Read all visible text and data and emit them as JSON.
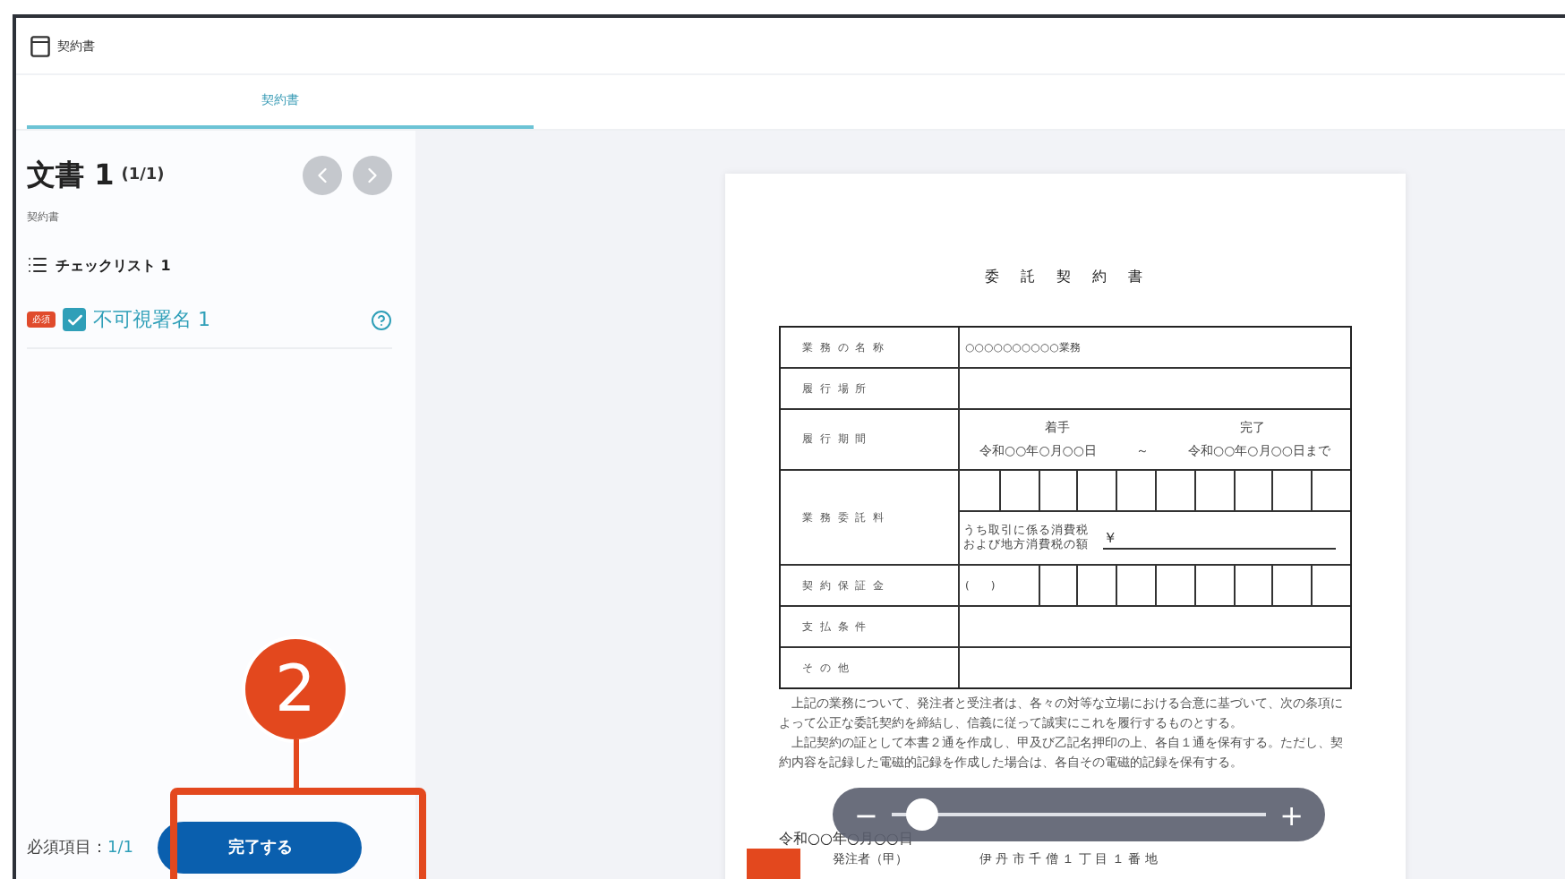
{
  "window": {
    "title": "契約書"
  },
  "tabs": [
    {
      "label": "契約書",
      "selected": true
    }
  ],
  "sidebar": {
    "heading": "文書 1",
    "count": "(1/1)",
    "subtitle": "契約書",
    "checklist": {
      "title": "チェックリスト 1",
      "items": [
        {
          "badge": "必須",
          "label": "不可視署名 1",
          "checked": true
        }
      ]
    },
    "required_label": "必須項目：",
    "required_count": "1/1",
    "complete_button": "完了する"
  },
  "document": {
    "title": "委　託　契　約　書",
    "rows": [
      {
        "kind": "text",
        "label": "業 務 の 名 称",
        "value": "○○○○○○○○○○業務"
      },
      {
        "kind": "text",
        "label": "履 行 場 所",
        "value": ""
      },
      {
        "kind": "period",
        "label": "履 行 期 間",
        "start_label": "着手",
        "end_label": "完了",
        "start": "令和○○年○月○○日",
        "sep": "～",
        "end": "令和○○年○月○○日まで"
      },
      {
        "kind": "fee",
        "label": "業 務 委 託 料",
        "tax_note": "うち取引に係る消費税および地方消費税の額",
        "yen": "￥"
      },
      {
        "kind": "deposit",
        "label": "契 約 保 証 金",
        "value": "(　　)"
      },
      {
        "kind": "text",
        "label": "支 払 条 件",
        "value": ""
      },
      {
        "kind": "text",
        "label": "そ の 他",
        "value": ""
      }
    ],
    "paragraphs": [
      "上記の業務について、発注者と受注者は、各々の対等な立場における合意に基づいて、次の条項によって公正な委託契約を締結し、信義に従って誠実にこれを履行するものとする。",
      "上記契約の証として本書２通を作成し、甲及び乙記名押印の上、各自１通を保有する。ただし、契約内容を記録した電磁的記録を作成した場合は、各自その電磁的記録を保有する。"
    ],
    "date": "令和○○年○月○○日",
    "party_label": "発注者（甲）",
    "party_address": "伊 丹 市 千 僧 １ 丁 目 １ 番 地"
  },
  "zoom": {
    "minus": "−",
    "plus": "+",
    "level": 0.08
  },
  "annotation": {
    "number": "2"
  }
}
